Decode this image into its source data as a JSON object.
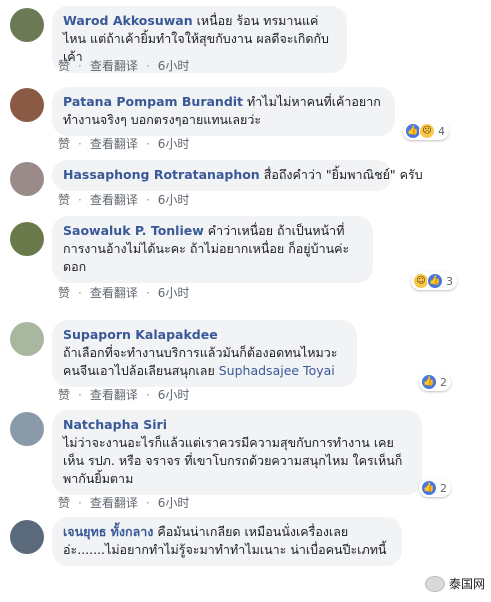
{
  "comments": [
    {
      "author": "Warod Akkosuwan",
      "text": "เหนื่อย ร้อน ทรมานแค่ไหน แต่ถ้าเค้ายิ้มทำใจให้สุขกับงาน ผลดีจะเกิดกับเค้า",
      "like": "赞",
      "translate": "查看翻译",
      "time": "6小时",
      "reaction_count": "",
      "avatar_color": "#6b7a55"
    },
    {
      "author": "Patana Pompam Burandit",
      "text": "ทำไมไม่หาคนที่เค้าอยากทำงานจริงๆ บอกตรงๆอายแทนเลยว่ะ",
      "like": "赞",
      "translate": "查看翻译",
      "time": "6小时",
      "reaction_count": "4",
      "avatar_color": "#8a5a44"
    },
    {
      "author": "Hassaphong Rotratanaphon",
      "text": "สื่อถึงคำว่า \"ยิ้มพาณิชย์\" ครับ",
      "like": "赞",
      "translate": "查看翻译",
      "time": "6小时",
      "reaction_count": "",
      "avatar_color": "#9a8a8a"
    },
    {
      "author": "Saowaluk P. Tonliew",
      "text": "คำว่าเหนื่อย ถ้าเป็นหน้าที่การงานอ้างไม่ได้นะคะ ถ้าไม่อยากเหนื่อย ก็อยู่บ้านค่ะดอก",
      "like": "赞",
      "translate": "查看翻译",
      "time": "6小时",
      "reaction_count": "3",
      "avatar_color": "#6a7a4a"
    },
    {
      "author": "Supaporn Kalapakdee",
      "text": "ถ้าเลือกที่จะทำงานบริการแล้วมันก็ต้องอดทนไหมวะ คนจีนเอาไปล้อเลียนสนุกเลย",
      "tag": "Suphadsajee Toyai",
      "like": "赞",
      "translate": "查看翻译",
      "time": "6小时",
      "reaction_count": "2",
      "avatar_color": "#a9b7a0"
    },
    {
      "author": "Natchapha Siri",
      "text": "ไม่ว่าจะงานอะไรก็แล้วแต่เราควรมีความสุขกับการทำงาน เคยเห็น รปภ. หรือ จราจร ที่เขาโบกรถด้วยความสนุกไหม ใครเห็นก็พากันยิ้มตาม",
      "like": "赞",
      "translate": "查看翻译",
      "time": "6小时",
      "reaction_count": "2",
      "avatar_color": "#8a9aa8"
    },
    {
      "author": "เจนยุทธ ทั้งกลาง",
      "text": "คือมันน่าเกลียด เหมือนนั่งเครื่องเลยอ่ะ.......ไม่อยากทำไม่รู้จะมาทำทำไมเนาะ น่าเบื่อคนปีะเภทนี้",
      "like": "",
      "translate": "",
      "time": "",
      "reaction_count": "",
      "avatar_color": "#5a6a7a"
    }
  ],
  "watermark": "泰国网"
}
